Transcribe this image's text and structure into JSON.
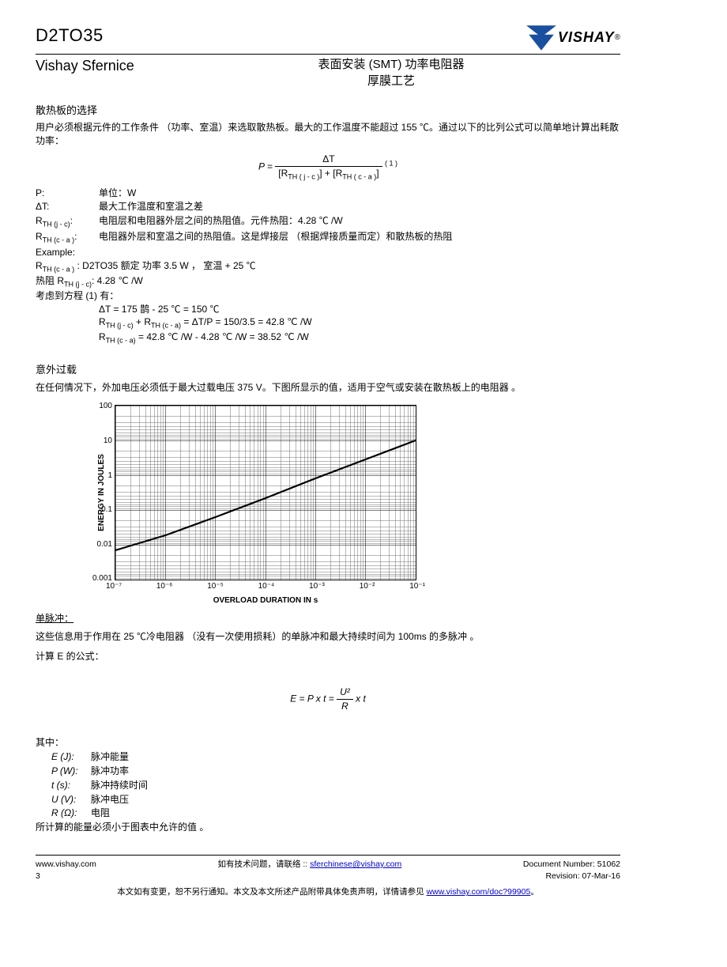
{
  "header": {
    "part_no": "D2TO35",
    "brand": "Vishay Sfernice",
    "title1": "表面安装 (SMT) 功率电阻器",
    "title2": "厚膜工艺",
    "logo_text": "VISHAY"
  },
  "heatsink": {
    "heading": "散热板的选择",
    "intro": "用户必须根据元件的工作条件 （功率、室温）来选取散热板。最大的工作温度不能超过 155 ℃。通过以下的比列公式可以简单地计算出耗散功率：",
    "formula_lhs": "P =",
    "formula_num": "ΔT",
    "formula_den_a": "[R",
    "formula_den_a_sub": "TH ( j - c )",
    "formula_den_mid": "] + [R",
    "formula_den_b_sub": "TH ( c - a )",
    "formula_den_end": "]",
    "formula_sup": "( 1 )",
    "defs": {
      "p_sym": "P:",
      "p_txt": "单位：W",
      "dt_sym": "ΔT:",
      "dt_txt": "最大工作温度和室温之差",
      "rjc_sym_a": "R",
      "rjc_sym_sub": "TH (j - c)",
      "rjc_sym_colon": ":",
      "rjc_txt": "电阻层和电阻器外层之间的热阻值。元件热阻：4.28 ℃ /W",
      "rca_sym_sub": "TH (c - a )",
      "rca_txt": "电阻器外层和室温之间的热阻值。这是焊接层 （根据焊接质量而定）和散热板的热阻",
      "example": "Example:",
      "ex1a": "R",
      "ex1a_sub": "TH (c - a )",
      "ex1b": " :  D2TO35 额定 功率 3.5 W ， 室温 + 25 ℃",
      "ex2a": "热阻 R",
      "ex2a_sub": "TH (j - c)",
      "ex2b": ": 4.28 ℃ /W",
      "ex3": "考虑到方程 (1) 有：",
      "calc1": "ΔT = 175 鹊 - 25 ℃ = 150 ℃",
      "calc2a": "R",
      "calc2a_sub": "TH (j - c)",
      "calc2b": " + R",
      "calc2b_sub": "TH (c - a)",
      "calc2c": " = ΔT/P = 150/3.5 = 42.8 ℃ /W",
      "calc3a": "R",
      "calc3a_sub": "TH (c - a)",
      "calc3b": " = 42.8 ℃ /W - 4.28 ℃ /W = 38.52 ℃ /W"
    }
  },
  "overload": {
    "heading": "意外过载",
    "text": "在任何情况下，外加电压必须低于最大过载电压 375 V。下图所显示的值，适用于空气或安装在散热板上的电阻器 。"
  },
  "chart_data": {
    "type": "line",
    "xlabel": "OVERLOAD DURATION IN s",
    "ylabel": "ENERGY IN JOULES",
    "x_log": true,
    "y_log": true,
    "x_ticks": [
      "10⁻⁷",
      "10⁻⁶",
      "10⁻⁵",
      "10⁻⁴",
      "10⁻³",
      "10⁻²",
      "10⁻¹"
    ],
    "y_ticks": [
      "100",
      "10",
      "1",
      "0.1",
      "0.01",
      "0.001"
    ],
    "series": [
      {
        "name": "energy",
        "x": [
          1e-07,
          1e-06,
          1e-05,
          0.0001,
          0.001,
          0.01,
          0.1
        ],
        "y": [
          0.0065,
          0.018,
          0.062,
          0.22,
          0.8,
          2.9,
          10
        ]
      }
    ]
  },
  "pulse": {
    "heading": "单脉冲：",
    "text": "这些信息用于作用在 25 ℃冷电阻器 （没有一次使用损耗）的单脉冲和最大持续时间为 100ms 的多脉冲 。",
    "calc_label": "计算 E 的公式：",
    "eq_lhs": "E = P x t =",
    "eq_num": "U²",
    "eq_den": "R",
    "eq_rhs": " x  t",
    "where": "其中：",
    "E_sym": "E (J):",
    "E_txt": "脉冲能量",
    "P_sym": "P (W):",
    "P_txt": "脉冲功率",
    "t_sym": "t (s):",
    "t_txt": "脉冲持续时间",
    "U_sym": "U (V):",
    "U_txt": "脉冲电压",
    "R_sym": "R (Ω):",
    "R_txt": "电阻",
    "note": "所计算的能量必须小于图表中允许的值 。"
  },
  "footer": {
    "url": "www.vishay.com",
    "page": "3",
    "tech_q": "如有技术问题，请联络 :: ",
    "email": "sferchinese@vishay.com",
    "docnum": "Document Number: 51062",
    "rev": "Revision: 07-Mar-16",
    "disclaimer_a": "本文如有变更，恕不另行通知。本文及本文所述产品附带具体免责声明，详情请参见 ",
    "disclaimer_link": "www.vishay.com/doc?99905",
    "disclaimer_b": "。"
  }
}
